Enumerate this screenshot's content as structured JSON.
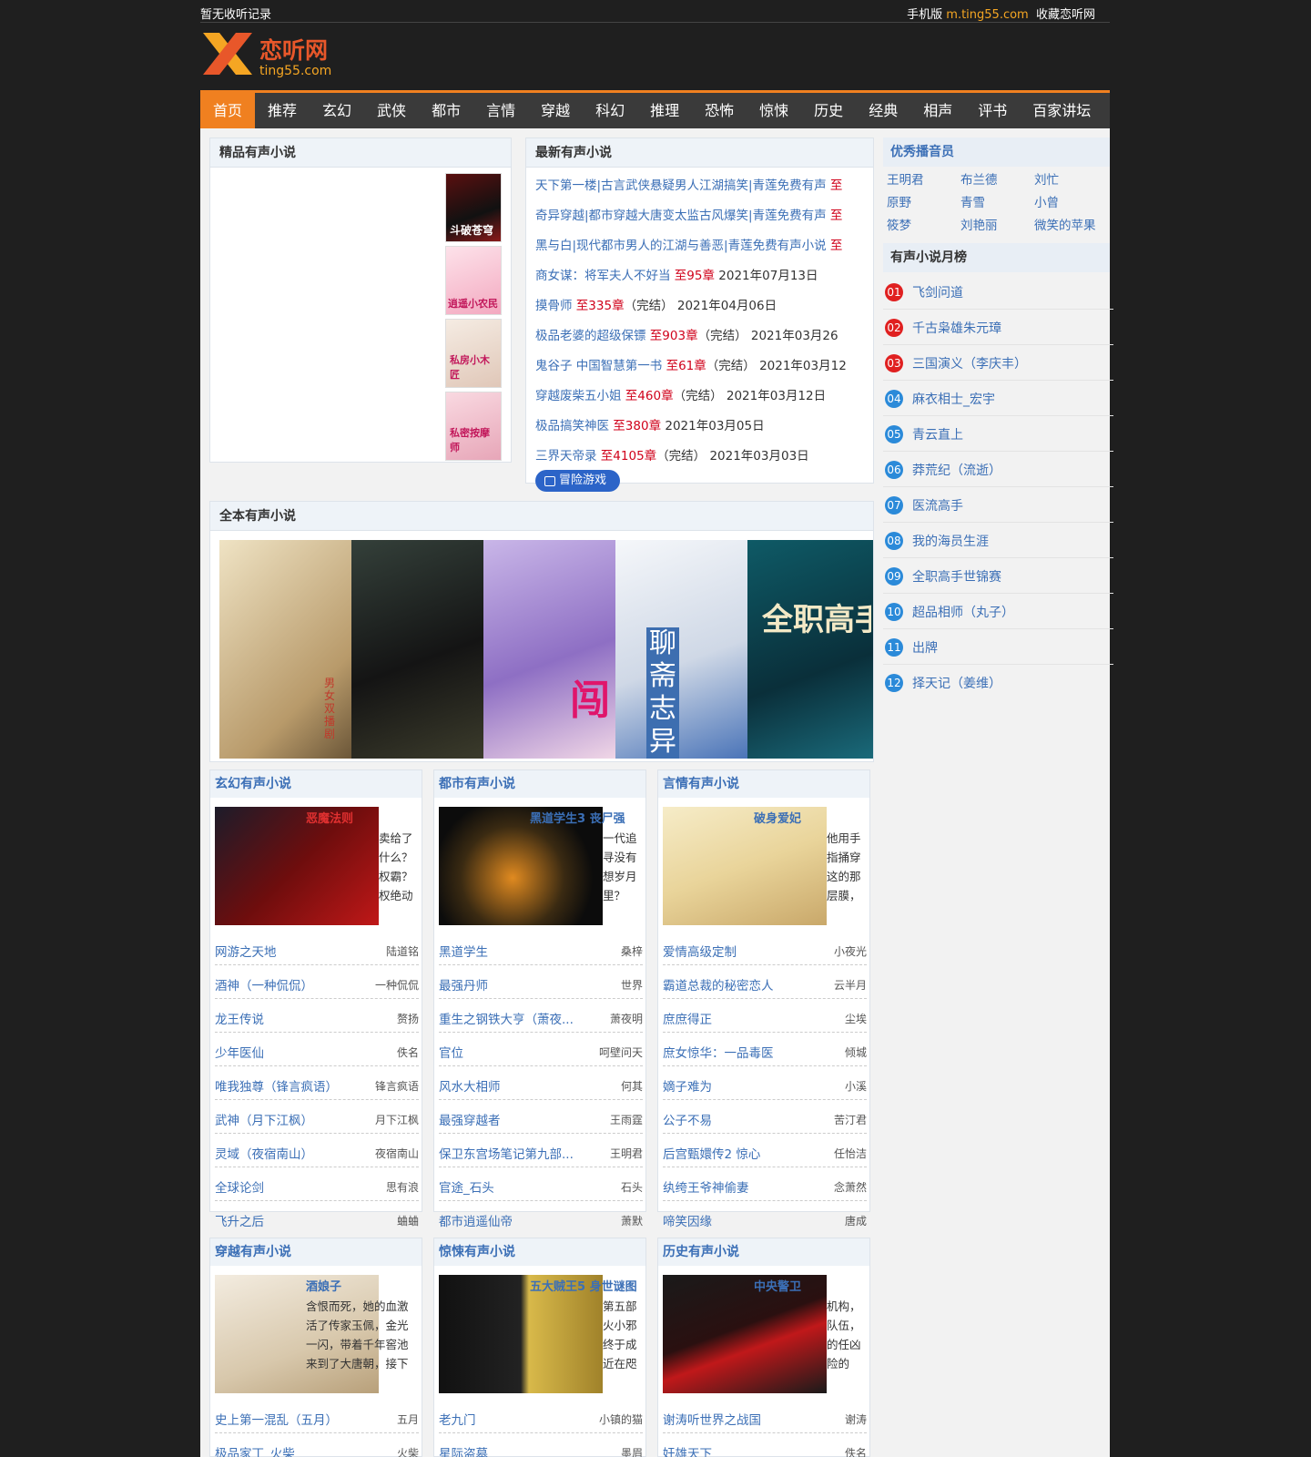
{
  "topbar": {
    "no_history": "暂无收听记录",
    "mobile_label": "手机版",
    "mobile_url": "m.ting55.com",
    "favorite": "收藏恋听网"
  },
  "logo": {
    "name": "恋听网",
    "domain": "ting55.com"
  },
  "nav": [
    "首页",
    "推荐",
    "玄幻",
    "武侠",
    "都市",
    "言情",
    "穿越",
    "科幻",
    "推理",
    "恐怖",
    "惊悚",
    "历史",
    "经典",
    "相声",
    "评书",
    "百家讲坛"
  ],
  "premium": {
    "title": "精品有声小说",
    "covers": [
      "斗破苍穹",
      "逍遥小农民",
      "私房小木匠",
      "私密按摩师"
    ]
  },
  "latest": {
    "title": "最新有声小说",
    "items": [
      {
        "t": "天下第一楼|古言武侠悬疑男人江湖搞笑|青莲免费有声",
        "c": "至",
        "d": ""
      },
      {
        "t": "奇异穿越|都市穿越大唐变太监古风爆笑|青莲免费有声",
        "c": "至",
        "d": ""
      },
      {
        "t": "黑与白|现代都市男人的江湖与善恶|青莲免费有声小说",
        "c": "至",
        "d": ""
      },
      {
        "t": "商女谋：将军夫人不好当",
        "c": "至95章",
        "d": "2021年07月13日"
      },
      {
        "t": "摸骨师",
        "c": "至335章",
        "d": "（完结） 2021年04月06日"
      },
      {
        "t": "极品老婆的超级保镖",
        "c": "至903章",
        "d": "（完结） 2021年03月26"
      },
      {
        "t": "鬼谷子 中国智慧第一书",
        "c": "至61章",
        "d": "（完结） 2021年03月12"
      },
      {
        "t": "穿越废柴五小姐",
        "c": "至460章",
        "d": "（完结） 2021年03月12日"
      },
      {
        "t": "极品搞笑神医",
        "c": "至380章",
        "d": "2021年03月05日"
      },
      {
        "t": "三界天帝录",
        "c": "至4105章",
        "d": "（完结） 2021年03月03日"
      }
    ],
    "badge": "冒险游戏"
  },
  "hosts": {
    "title": "优秀播音员",
    "names": [
      "王明君",
      "布兰德",
      "刘忙",
      "原野",
      "青雪",
      "小曾",
      "筱梦",
      "刘艳丽",
      "微笑的苹果"
    ]
  },
  "ranking": {
    "title": "有声小说月榜",
    "items": [
      {
        "n": "01",
        "t": "飞剑问道"
      },
      {
        "n": "02",
        "t": "千古枭雄朱元璋"
      },
      {
        "n": "03",
        "t": "三国演义（李庆丰）"
      },
      {
        "n": "04",
        "t": "麻衣相士_宏宇"
      },
      {
        "n": "05",
        "t": "青云直上"
      },
      {
        "n": "06",
        "t": "莽荒纪（流逝）"
      },
      {
        "n": "07",
        "t": "医流高手"
      },
      {
        "n": "08",
        "t": "我的海员生涯"
      },
      {
        "n": "09",
        "t": "全职高手世锦赛"
      },
      {
        "n": "10",
        "t": "超品相师（丸子）"
      },
      {
        "n": "11",
        "t": "出牌"
      },
      {
        "n": "12",
        "t": "择天记（姜维）"
      }
    ]
  },
  "featured": {
    "title": "全本有声小说",
    "covers": [
      "男女双播剧",
      "",
      "闯",
      "聊斋志异",
      "全职高手"
    ]
  },
  "categories": [
    {
      "title": "玄幻有声小说",
      "book": "恶魔法则",
      "desc": "卖给了什么？权霸？权绝动人...",
      "rows": [
        {
          "a": "网游之天地",
          "b": "陆道铭"
        },
        {
          "a": "酒神（一种侃侃）",
          "b": "一种侃侃"
        },
        {
          "a": "龙王传说",
          "b": "赘扬"
        },
        {
          "a": "少年医仙",
          "b": "佚名"
        },
        {
          "a": "唯我独尊（锋言疯语）",
          "b": "锋言疯语"
        },
        {
          "a": "武神（月下江枫）",
          "b": "月下江枫"
        },
        {
          "a": "灵域（夜宿南山）",
          "b": "夜宿南山"
        },
        {
          "a": "全球论剑",
          "b": "思有浪"
        },
        {
          "a": "飞升之后",
          "b": "蛐蛐"
        }
      ]
    },
    {
      "title": "都市有声小说",
      "book": "黑道学生3 丧尸强",
      "desc": "一代追寻没有想岁月里？",
      "rows": [
        {
          "a": "黑道学生",
          "b": "桑梓"
        },
        {
          "a": "最强丹师",
          "b": "世界"
        },
        {
          "a": "重生之钢铁大亨（萧夜...",
          "b": "萧夜明"
        },
        {
          "a": "官位",
          "b": "呵壁问天"
        },
        {
          "a": "风水大相师",
          "b": "何其"
        },
        {
          "a": "最强穿越者",
          "b": "王雨霆"
        },
        {
          "a": "保卫东宫场笔记第九部...",
          "b": "王明君"
        },
        {
          "a": "官途_石头",
          "b": "石头"
        },
        {
          "a": "都市逍遥仙帝",
          "b": "萧默"
        }
      ]
    },
    {
      "title": "言情有声小说",
      "book": "破身爱妃",
      "desc": "他用手指捅穿这的那层膜，王压在她身上已失",
      "rows": [
        {
          "a": "爱情高级定制",
          "b": "小夜光"
        },
        {
          "a": "霸道总裁的秘密恋人",
          "b": "云半月"
        },
        {
          "a": "庶庶得正",
          "b": "尘埃"
        },
        {
          "a": "庶女惊华：一品毒医",
          "b": "倾城"
        },
        {
          "a": "嫡子难为",
          "b": "小溪"
        },
        {
          "a": "公子不易",
          "b": "苦汀君"
        },
        {
          "a": "后宫甄嬛传2 惊心",
          "b": "任怡洁"
        },
        {
          "a": "纨绔王爷神偷妻",
          "b": "念萧然"
        },
        {
          "a": "啼笑因缘",
          "b": "唐成"
        }
      ]
    },
    {
      "title": "穿越有声小说",
      "book": "酒娘子",
      "desc": "含恨而死，她的血激活了传家玉佩，金光一闪，带着千年窖池来到了大唐朝，接下来上演的...",
      "rows": [
        {
          "a": "史上第一混乱（五月）",
          "b": "五月"
        },
        {
          "a": "极品家丁_火柴",
          "b": "火柴"
        }
      ]
    },
    {
      "title": "惊悚有声小说",
      "book": "五大贼王5 身世谜图",
      "desc": "第五部 火小邪 终于成 近在咫",
      "rows": [
        {
          "a": "老九门",
          "b": "小镇的猫"
        },
        {
          "a": "星际盗墓",
          "b": "墨眉"
        }
      ]
    },
    {
      "title": "历史有声小说",
      "book": "中央警卫",
      "desc": "机构，队伍，的任凶险的",
      "rows": [
        {
          "a": "谢涛听世界之战国",
          "b": "谢涛"
        },
        {
          "a": "奸雄天下",
          "b": "佚名"
        }
      ]
    }
  ]
}
